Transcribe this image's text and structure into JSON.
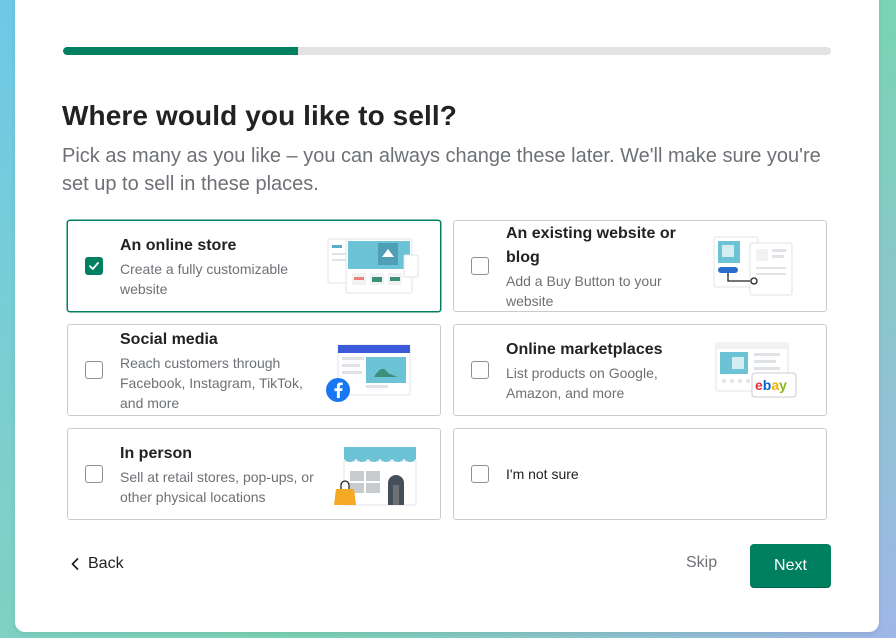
{
  "progress": {
    "fraction": 0.306
  },
  "heading": {
    "title": "Where would you like to sell?"
  },
  "subtitle": "Pick as many as you like – you can always change these later. We'll make sure you're set up to sell in these places.",
  "options": [
    {
      "title": "An online store",
      "desc": "Create a fully customizable website",
      "checked": true,
      "icon": "online-store-illustration"
    },
    {
      "title": "An existing website or blog",
      "desc": "Add a Buy Button to your website",
      "checked": false,
      "icon": "buy-button-illustration"
    },
    {
      "title": "Social media",
      "desc": "Reach customers through Facebook, Instagram, TikTok, and more",
      "checked": false,
      "icon": "social-media-illustration"
    },
    {
      "title": "Online marketplaces",
      "desc": "List products on Google, Amazon, and more",
      "checked": false,
      "icon": "marketplace-illustration",
      "badge": "ebay"
    },
    {
      "title": "In person",
      "desc": "Sell at retail stores, pop-ups, or other physical locations",
      "checked": false,
      "icon": "storefront-illustration"
    },
    {
      "title": "I'm not sure",
      "checked": false
    }
  ],
  "footer": {
    "back": "Back",
    "skip": "Skip",
    "next": "Next"
  },
  "colors": {
    "accent": "#008060",
    "track": "#e3e3e3",
    "text": "#202223",
    "muted": "#6d7175"
  }
}
